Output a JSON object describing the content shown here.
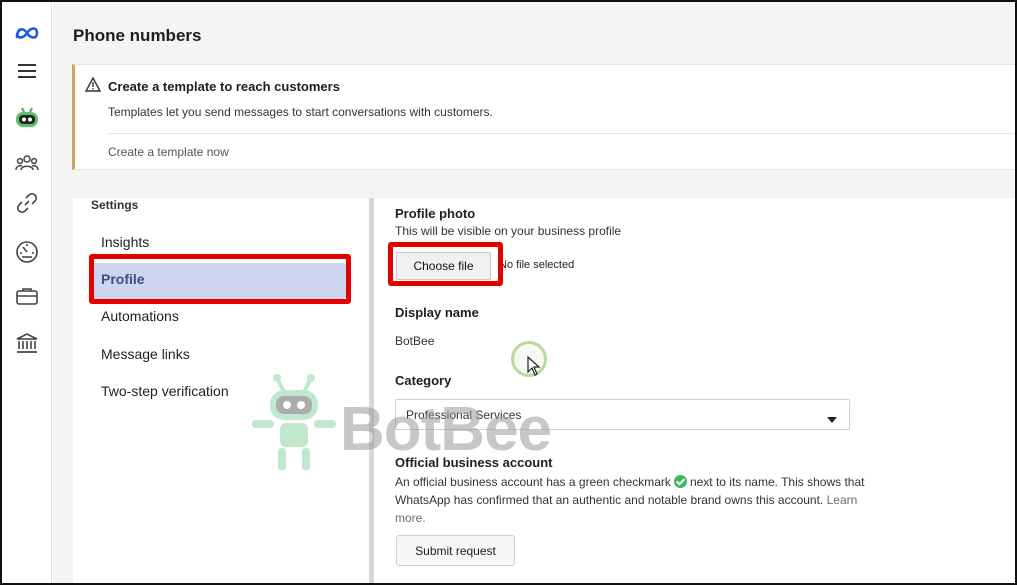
{
  "page_title": "Phone numbers",
  "banner": {
    "title": "Create a template to reach customers",
    "text": "Templates let you send messages to start conversations with customers.",
    "link": "Create a template now"
  },
  "settings": {
    "heading": "Settings",
    "items": [
      {
        "label": "Insights"
      },
      {
        "label": "Profile"
      },
      {
        "label": "Automations"
      },
      {
        "label": "Message links"
      },
      {
        "label": "Two-step verification"
      }
    ],
    "active_index": 1
  },
  "profile": {
    "photo_label": "Profile photo",
    "photo_sub": "This will be visible on your business profile",
    "choose_file": "Choose file",
    "no_file": "No file selected",
    "display_name_label": "Display name",
    "display_name_value": "BotBee",
    "category_label": "Category",
    "category_value": "Professional Services",
    "official_label": "Official business account",
    "official_text_1": "An official business account has a green checkmark",
    "official_text_2": "next to its name. This shows that WhatsApp has confirmed that an authentic and notable brand owns this account.",
    "learn_more": "Learn more.",
    "submit": "Submit request"
  },
  "watermark": "BotBee",
  "colors": {
    "highlight": "#e50000",
    "active_nav": "#ccd4ef",
    "checkmark": "#3cb85c",
    "banner_accent": "#c9a86a"
  }
}
